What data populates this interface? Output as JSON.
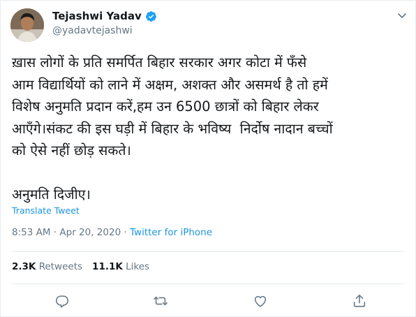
{
  "author": {
    "name": "Tejashwi Yadav",
    "handle": "@yadavtejashwi",
    "avatar_icon": "profile-photo",
    "verified_icon": "verified-badge-icon"
  },
  "tweet": {
    "text": "ख़ास लोगों के प्रति समर्पित बिहार सरकार अगर कोटा में फँसे\nआम विद्यार्थियों को लाने में अक्षम, अशक्त और असमर्थ है तो हमें\nविशेष अनुमति प्रदान करें,हम उन 6500 छात्रों को बिहार लेकर\nआएँगे।संकट की इस घड़ी में बिहार के भविष्य  निर्दोष नादान बच्चों\nको ऐसे नहीं छोड़ सकते।\n\nअनुमति दिजीए।",
    "translate_label": "Translate Tweet",
    "time": "8:53 AM",
    "separator": "·",
    "date": "Apr 20, 2020",
    "source": "Twitter for iPhone"
  },
  "stats": {
    "retweets_count": "2.3K",
    "retweets_label": "Retweets",
    "likes_count": "11.1K",
    "likes_label": "Likes"
  },
  "colors": {
    "link": "#1b95e0",
    "muted": "#657786",
    "text": "#14171a",
    "verified": "#1da1f2"
  }
}
